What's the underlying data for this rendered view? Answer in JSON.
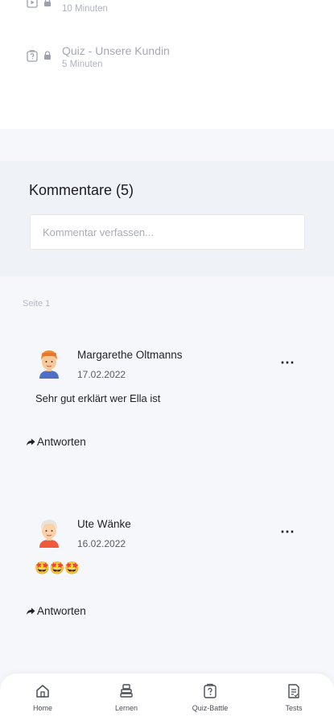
{
  "lessons": [
    {
      "title": "",
      "duration": "10 Minuten"
    },
    {
      "title": "Quiz - Unsere Kundin",
      "duration": "5 Minuten"
    }
  ],
  "comments_section": {
    "title": "Kommentare (5)",
    "input_placeholder": "Kommentar verfassen...",
    "page_label": "Seite 1"
  },
  "comments": [
    {
      "author": "Margarethe Oltmanns",
      "date": "17.02.2022",
      "text": "Sehr gut erklärt wer Ella ist",
      "reply_label": "Antworten"
    },
    {
      "author": "Ute Wänke",
      "date": "16.02.2022",
      "text": "🤩🤩🤩",
      "reply_label": "Antworten"
    }
  ],
  "tabbar": {
    "items": [
      {
        "label": "Home",
        "icon": "home-icon"
      },
      {
        "label": "Lernen",
        "icon": "lernen-icon"
      },
      {
        "label": "Quiz-Battle",
        "icon": "quiz-battle-icon"
      },
      {
        "label": "Tests",
        "icon": "tests-icon"
      }
    ]
  }
}
